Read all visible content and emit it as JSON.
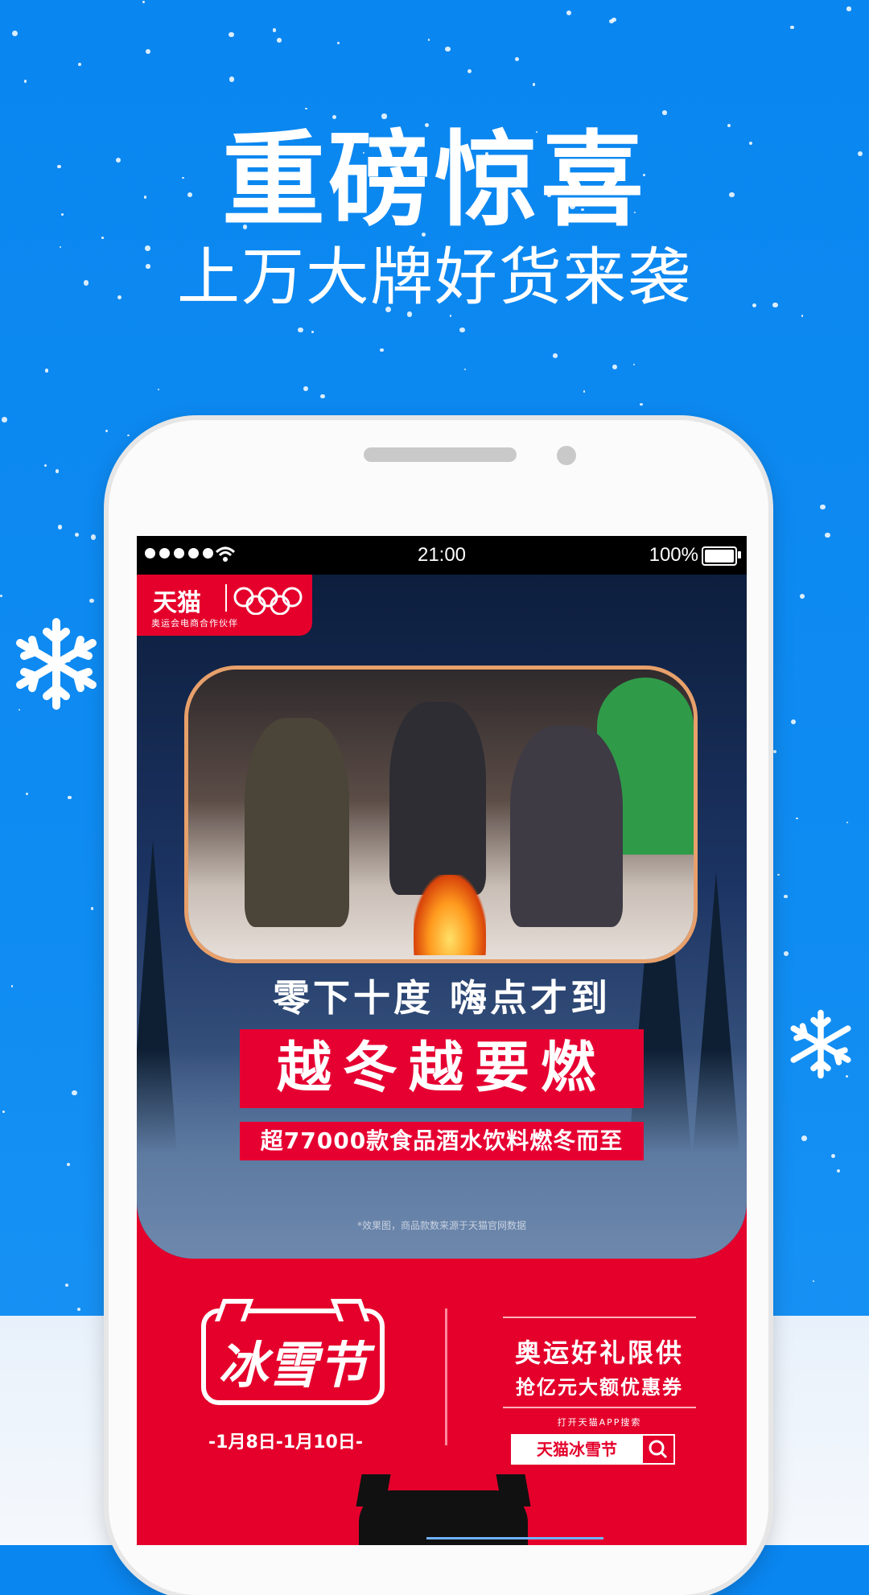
{
  "promo": {
    "headline": "重磅惊喜",
    "subheadline": "上万大牌好货来袭"
  },
  "status_bar": {
    "time": "21:00",
    "battery": "100%"
  },
  "banner": {
    "brand": "天猫",
    "brand_sub": "奥运会电商合作伙伴",
    "slogan_line1": "零下十度 嗨点才到",
    "slogan_line2": "越冬越要燃",
    "slogan_line3": "超77000款食品酒水饮料燃冬而至",
    "footnote": "*效果图，商品款数来源于天猫官网数据"
  },
  "festival": {
    "name": "冰雪节",
    "dates": "-1月8日-1月10日-",
    "promo_line1": "奥运好礼限供",
    "promo_line2": "抢亿元大额优惠券",
    "promo_hint": "打开天猫APP搜索",
    "search_text": "天猫冰雪节"
  },
  "colors": {
    "background_blue": "#0f8cf2",
    "tmall_red": "#e4002b",
    "status_bar": "#000000"
  }
}
